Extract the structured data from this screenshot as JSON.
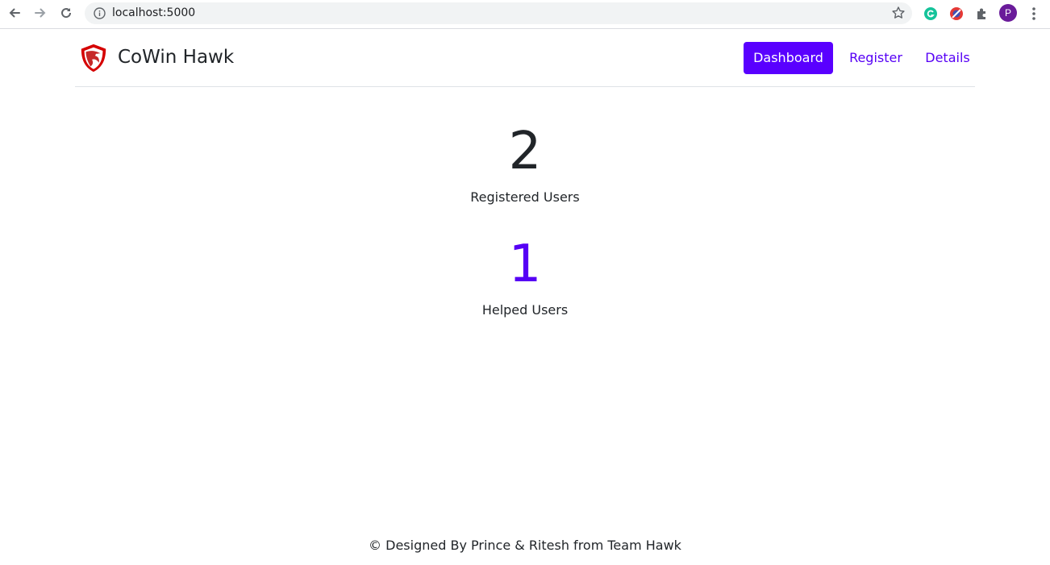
{
  "browser": {
    "url": "localhost:5000",
    "avatar_letter": "P",
    "extensions": [
      "grammarly-icon",
      "adblock-icon",
      "puzzle-icon"
    ]
  },
  "header": {
    "brand": "CoWin Hawk",
    "nav": [
      {
        "label": "Dashboard",
        "active": true
      },
      {
        "label": "Register",
        "active": false
      },
      {
        "label": "Details",
        "active": false
      }
    ]
  },
  "stats": [
    {
      "value": "2",
      "label": "Registered Users",
      "color": "#212529"
    },
    {
      "value": "1",
      "label": "Helped Users",
      "color": "#5600f5"
    }
  ],
  "footer": {
    "text": "© Designed By Prince & Ritesh from Team Hawk"
  },
  "colors": {
    "accent": "#5900ff",
    "logo_red": "#d50000"
  }
}
